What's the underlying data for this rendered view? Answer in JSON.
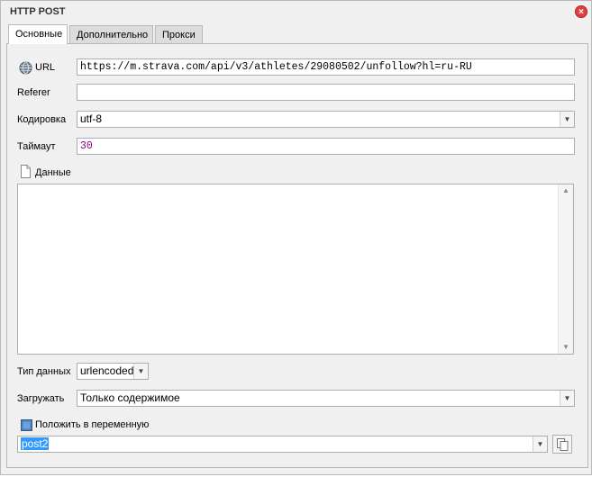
{
  "window": {
    "title": "HTTP POST",
    "close_glyph": "×"
  },
  "tabs": [
    {
      "label": "Основные",
      "active": true
    },
    {
      "label": "Дополнительно",
      "active": false
    },
    {
      "label": "Прокси",
      "active": false
    }
  ],
  "form": {
    "url": {
      "label": "URL",
      "value": "https://m.strava.com/api/v3/athletes/29080502/unfollow?hl=ru-RU",
      "icon": "globe-icon"
    },
    "referer": {
      "label": "Referer",
      "value": ""
    },
    "encoding": {
      "label": "Кодировка",
      "value": "utf-8"
    },
    "timeout": {
      "label": "Таймаут",
      "value": "30",
      "value_color": "#800080"
    },
    "data": {
      "label": "Данные",
      "value": "",
      "icon": "document-icon"
    },
    "data_type": {
      "label": "Тип данных",
      "value": "urlencoded"
    },
    "load": {
      "label": "Загружать",
      "value": "Только содержимое"
    },
    "store": {
      "checkbox_label": "Положить в переменную",
      "checked": true,
      "variable": "post2"
    }
  },
  "colors": {
    "selection": "#3399ff",
    "close": "#e04040"
  }
}
